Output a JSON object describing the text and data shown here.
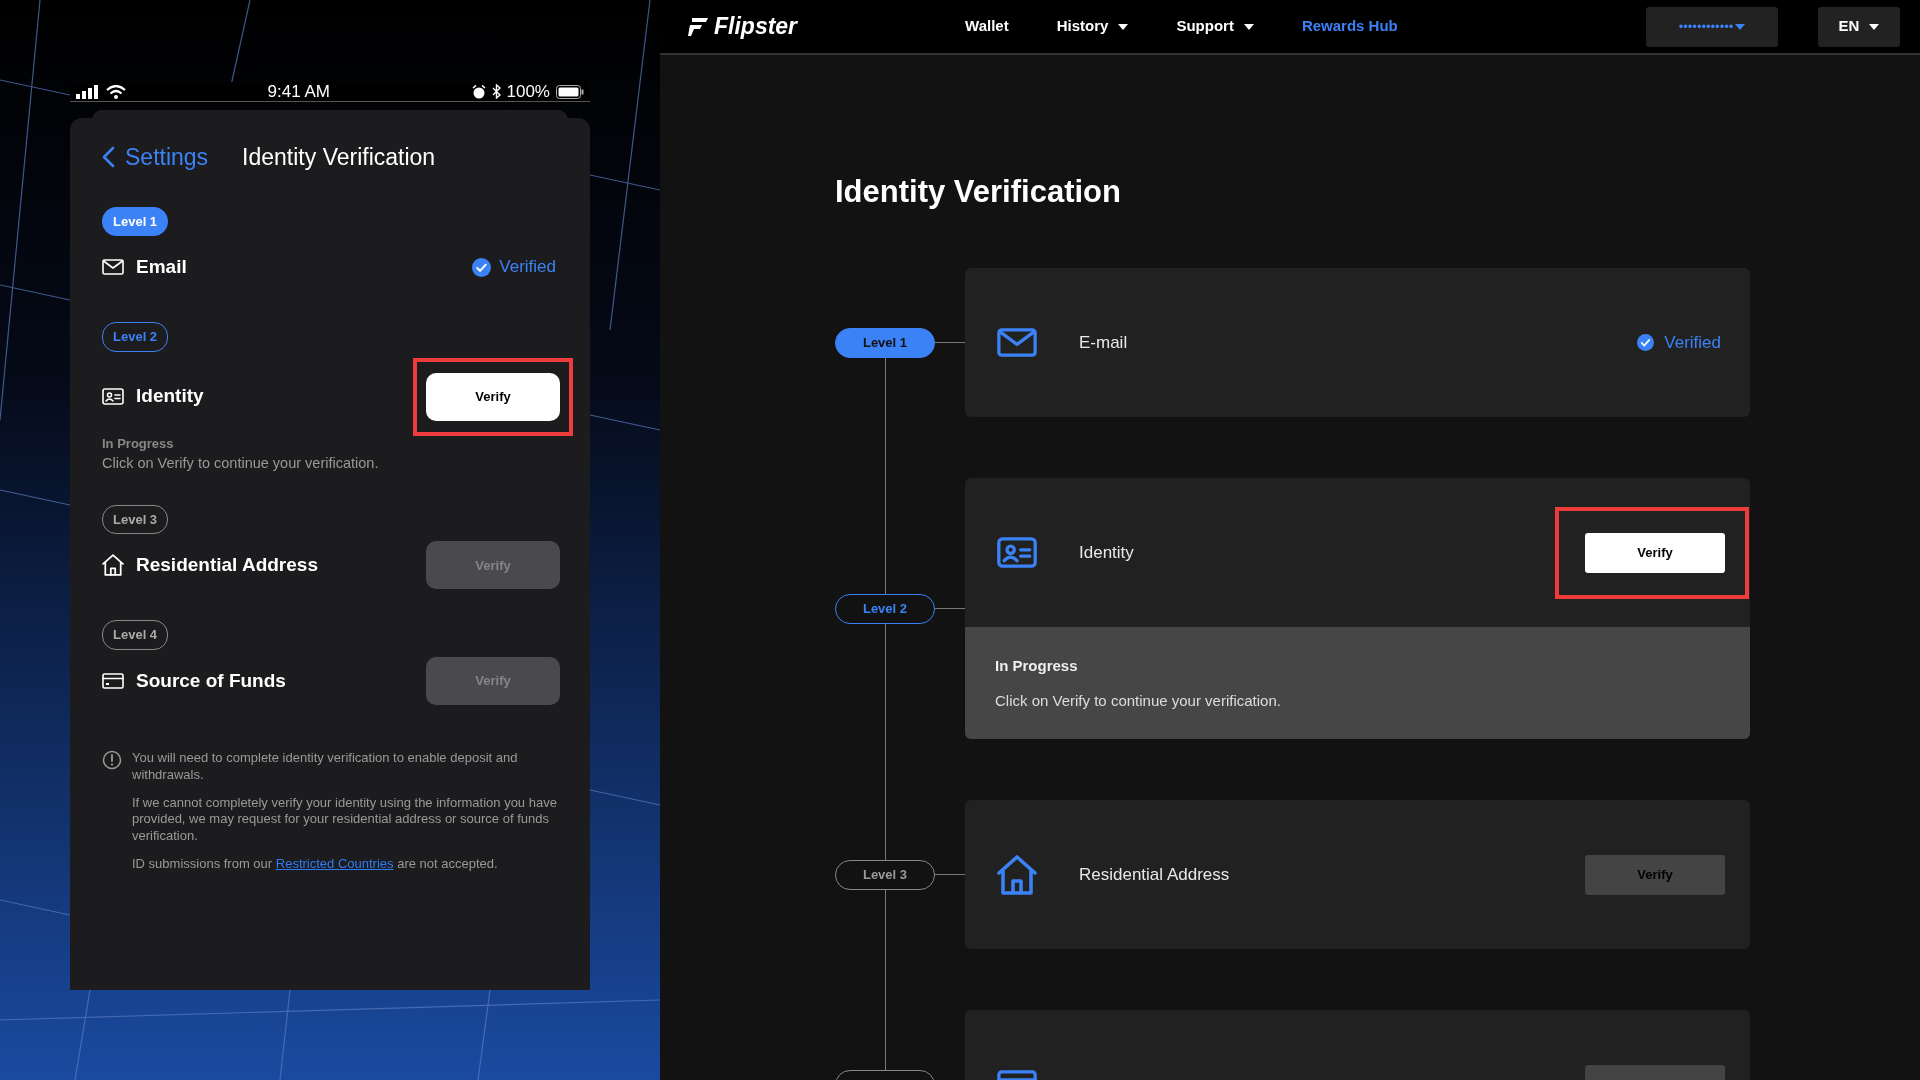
{
  "phone": {
    "status_bar": {
      "time": "9:41 AM",
      "battery": "100%"
    },
    "header": {
      "back": "Settings",
      "title": "Identity Verification"
    },
    "levels": [
      {
        "level": "Level 1",
        "kind": "email",
        "name": "Email",
        "verified": true,
        "verified_text": "Verified",
        "highlighted": false
      },
      {
        "level": "Level 2",
        "kind": "identity",
        "name": "Identity",
        "verified": false,
        "disabled": false,
        "button": "Verify",
        "highlighted": true,
        "note": {
          "title": "In Progress",
          "text": "Click on Verify to continue your verification."
        }
      },
      {
        "level": "Level 3",
        "kind": "address",
        "name": "Residential Address",
        "verified": false,
        "disabled": true,
        "button": "Verify",
        "highlighted": false
      },
      {
        "level": "Level 4",
        "kind": "funds",
        "name": "Source of Funds",
        "verified": false,
        "disabled": true,
        "button": "Verify",
        "highlighted": false
      }
    ],
    "notes": [
      {
        "text": "You will need to complete identity verification to enable deposit and withdrawals."
      },
      {
        "text": "If we cannot completely verify your identity using the information you have provided, we may request for your residential address or source of funds verification."
      },
      {
        "text": "ID submissions from our ",
        "link": "Restricted Countries",
        "after": " are not accepted."
      }
    ]
  },
  "web": {
    "navbar": {
      "brand": "Flipster",
      "links": [
        {
          "label": "Wallet",
          "dropdown": false,
          "selected": false
        },
        {
          "label": "History",
          "dropdown": true,
          "selected": false
        },
        {
          "label": "Support",
          "dropdown": true,
          "selected": false
        },
        {
          "label": "Rewards Hub",
          "dropdown": false,
          "selected": true
        }
      ],
      "account": "••••••••••••",
      "language": "EN"
    },
    "title": "Identity Verification",
    "steps": [
      {
        "level": "Level 1",
        "kind": "email",
        "name": "E-mail",
        "verified": true,
        "verified_text": "Verified",
        "highlighted": false
      },
      {
        "level": "Level 2",
        "kind": "identity",
        "name": "Identity",
        "verified": false,
        "disabled": false,
        "button": "Verify",
        "highlighted": true,
        "note": {
          "title": "In Progress",
          "text": "Click on Verify to continue your verification."
        }
      },
      {
        "level": "Level 3",
        "kind": "address",
        "name": "Residential Address",
        "verified": false,
        "disabled": true,
        "button": "Verify",
        "highlighted": false
      },
      {
        "kind": "funds",
        "verified": false,
        "disabled": true,
        "highlighted": false
      }
    ]
  }
}
